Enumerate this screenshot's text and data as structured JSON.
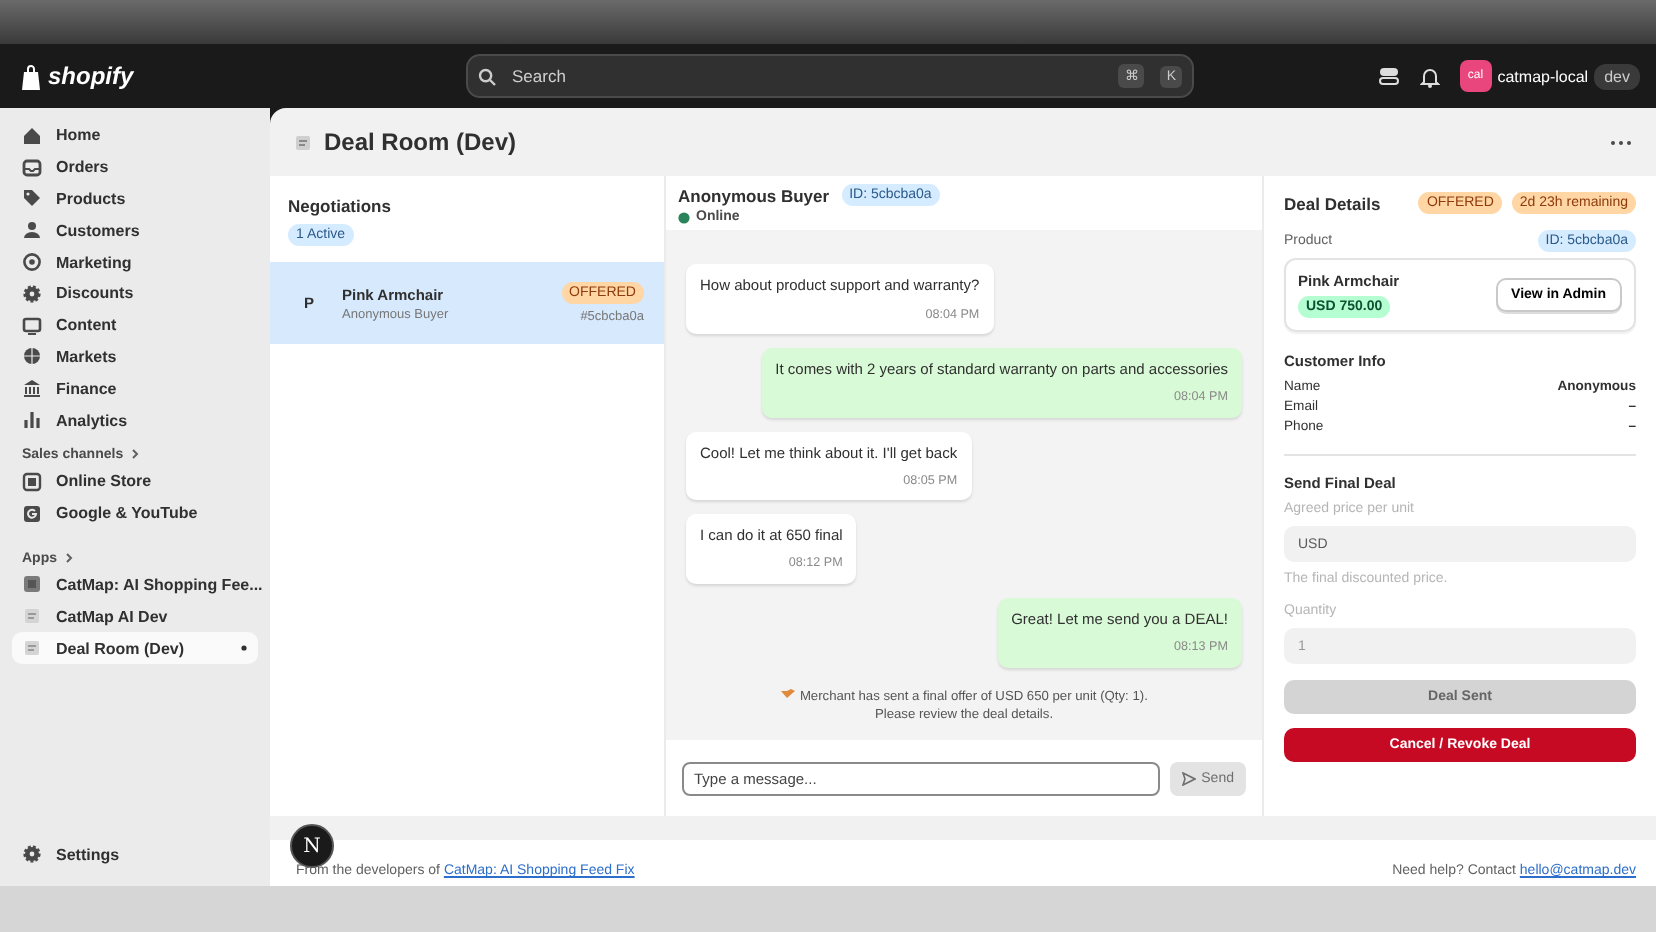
{
  "topbar": {
    "logo": "shopify",
    "search": {
      "placeholder": "Search"
    },
    "shortcut": [
      "⌘",
      "K"
    ],
    "store": {
      "avatar": "cal",
      "name": "catmap-local",
      "badge": "dev"
    }
  },
  "sidebar": {
    "items": [
      {
        "label": "Home",
        "selected": false
      },
      {
        "label": "Orders",
        "selected": false
      },
      {
        "label": "Products",
        "selected": false
      },
      {
        "label": "Customers",
        "selected": false
      },
      {
        "label": "Marketing",
        "selected": false
      },
      {
        "label": "Discounts",
        "selected": false
      },
      {
        "label": "Content",
        "selected": false
      },
      {
        "label": "Markets",
        "selected": false
      },
      {
        "label": "Finance",
        "selected": false
      },
      {
        "label": "Analytics",
        "selected": false
      }
    ],
    "sales_channels": {
      "title": "Sales channels",
      "items": [
        {
          "label": "Online Store",
          "selected": false
        },
        {
          "label": "Google & YouTube",
          "selected": false
        }
      ]
    },
    "apps": {
      "title": "Apps",
      "items": [
        {
          "label": "CatMap: AI Shopping Fee...",
          "selected": false
        },
        {
          "label": "CatMap AI Dev",
          "selected": false
        },
        {
          "label": "Deal Room (Dev)",
          "selected": true
        }
      ]
    },
    "settings": "Settings"
  },
  "page": {
    "title": "Deal Room (Dev)"
  },
  "negotiations": {
    "title": "Negotiations",
    "badge": "1 Active",
    "items": [
      {
        "avatar": "P",
        "product": "Pink Armchair",
        "buyer": "Anonymous Buyer",
        "status": "OFFERED",
        "id": "#5cbcba0a",
        "selected": true
      }
    ]
  },
  "chat": {
    "buyer": "Anonymous Buyer",
    "id": "ID: 5cbcba0a",
    "status": "Online",
    "online": true,
    "messages": [
      {
        "kind": "incoming",
        "text": "How about product support and warranty?",
        "time": "08:04 PM"
      },
      {
        "kind": "outgoing",
        "text": "It comes with 2 years of standard warranty on parts and accessories",
        "time": "08:04 PM"
      },
      {
        "kind": "incoming",
        "text": "Cool! Let me think about it. I'll get back",
        "time": "08:05 PM"
      },
      {
        "kind": "incoming",
        "text": "I can do it at 650 final",
        "time": "08:12 PM"
      },
      {
        "kind": "outgoing",
        "text": "Great! Let me send you a DEAL!",
        "time": "08:13 PM"
      },
      {
        "kind": "system",
        "text": "Merchant has sent a final offer of USD 650 per unit (Qty: 1). Please review the deal details."
      }
    ],
    "composer": {
      "placeholder": "Type a message...",
      "send": "Send",
      "send_disabled": true
    }
  },
  "details": {
    "title": "Deal Details",
    "badges": [
      "OFFERED",
      "2d 23h remaining"
    ],
    "product": {
      "label": "Product",
      "id": "ID: 5cbcba0a",
      "name": "Pink Armchair",
      "price": "USD 750.00",
      "button": "View in Admin"
    },
    "customer": {
      "title": "Customer Info",
      "rows": [
        {
          "label": "Name",
          "value": "Anonymous"
        },
        {
          "label": "Email",
          "value": "–"
        },
        {
          "label": "Phone",
          "value": "–"
        }
      ]
    },
    "send": {
      "title": "Send Final Deal",
      "price_label": "Agreed price per unit",
      "price_prefix": "USD",
      "hint": "The final discounted price.",
      "quantity_label": "Quantity",
      "quantity": "1",
      "quantity_disabled": true,
      "submit": "Deal Sent",
      "submit_disabled": true,
      "cancel": "Cancel / Revoke Deal"
    }
  },
  "footer": {
    "text": "From the developers of",
    "link": "CatMap: AI Shopping Feed Fix",
    "help": "Need help? Contact",
    "email": "hello@catmap.dev"
  },
  "dev_badge": "N"
}
